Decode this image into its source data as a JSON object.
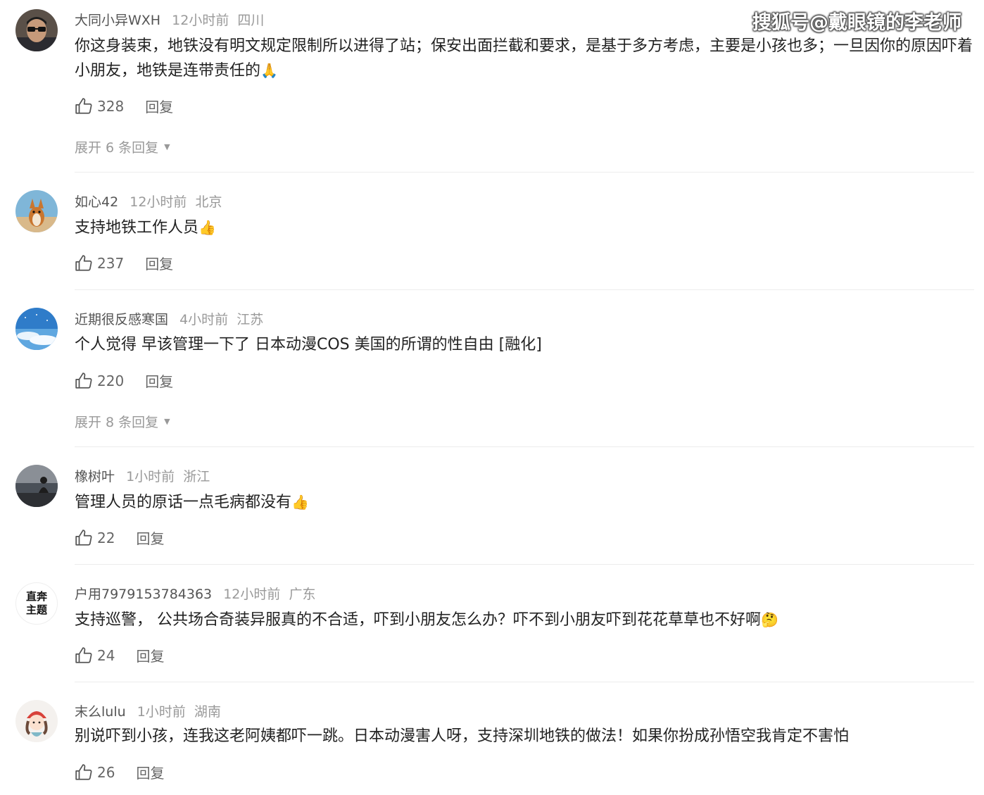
{
  "watermark": "搜狐号@戴眼镜的李老师",
  "comments": [
    {
      "user": "大同小异WXH",
      "time": "12小时前",
      "loc": "四川",
      "text": "你这身装束，地铁没有明文规定限制所以进得了站；保安出面拦截和要求，是基于多方考虑，主要是小孩也多；一旦因你的原因吓着小朋友，地铁是连带责任的",
      "emoji": "🙏",
      "avatar_icon": "man-glasses-avatar",
      "likes": "328",
      "reply": "回复",
      "expand": "展开 6 条回复"
    },
    {
      "user": "如心42",
      "time": "12小时前",
      "loc": "北京",
      "text": "支持地铁工作人员",
      "emoji": "👍",
      "avatar_icon": "corgi-dog-avatar",
      "likes": "237",
      "reply": "回复"
    },
    {
      "user": "近期很反感寒国",
      "time": "4小时前",
      "loc": "江苏",
      "text": "个人觉得 早该管理一下了 日本动漫COS 美国的所谓的性自由 [融化]",
      "avatar_icon": "sky-clouds-avatar",
      "likes": "220",
      "reply": "回复",
      "expand": "展开 8 条回复"
    },
    {
      "user": "橡树叶",
      "time": "1小时前",
      "loc": "浙江",
      "text": "管理人员的原话一点毛病都没有",
      "emoji": "👍",
      "avatar_icon": "seaside-person-avatar",
      "likes": "22",
      "reply": "回复"
    },
    {
      "user": "户用7979153784363",
      "time": "12小时前",
      "loc": "广东",
      "text": "支持巡警， 公共场合奇装异服真的不合适，吓到小朋友怎么办？吓不到小朋友吓到花花草草也不好啊",
      "emoji": "🤔",
      "avatar_icon": "text-logo-avatar",
      "avatar_text": [
        "直奔",
        "主题"
      ],
      "likes": "24",
      "reply": "回复"
    },
    {
      "user": "末么lulu",
      "time": "1小时前",
      "loc": "湖南",
      "text": "别说吓到小孩，连我这老阿姨都吓一跳。日本动漫害人呀，支持深圳地铁的做法！如果你扮成孙悟空我肯定不害怕",
      "avatar_icon": "cartoon-girl-avatar",
      "likes": "26",
      "reply": "回复"
    }
  ]
}
